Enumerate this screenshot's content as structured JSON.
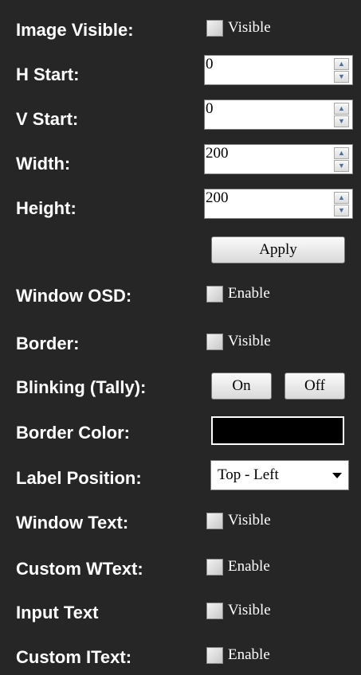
{
  "image_visible": {
    "label": "Image Visible:",
    "checkbox_label": "Visible"
  },
  "h_start": {
    "label": "H Start:",
    "value": "0"
  },
  "v_start": {
    "label": "V Start:",
    "value": "0"
  },
  "width": {
    "label": "Width:",
    "value": "200"
  },
  "height": {
    "label": "Height:",
    "value": "200"
  },
  "apply_button": "Apply",
  "window_osd": {
    "label": "Window OSD:",
    "checkbox_label": "Enable"
  },
  "border": {
    "label": "Border:",
    "checkbox_label": "Visible"
  },
  "blinking": {
    "label": "Blinking (Tally):",
    "on_label": "On",
    "off_label": "Off"
  },
  "border_color": {
    "label": "Border Color:",
    "value": "#000000"
  },
  "label_position": {
    "label": "Label Position:",
    "selected": "Top - Left"
  },
  "window_text": {
    "label": "Window Text:",
    "checkbox_label": "Visible"
  },
  "custom_wtext": {
    "label": "Custom WText:",
    "checkbox_label": "Enable"
  },
  "input_text": {
    "label": "Input Text",
    "checkbox_label": "Visible"
  },
  "custom_itext": {
    "label": "Custom IText:",
    "checkbox_label": "Enable"
  },
  "colors": {
    "background": "#262626",
    "text": "#ffffff"
  }
}
